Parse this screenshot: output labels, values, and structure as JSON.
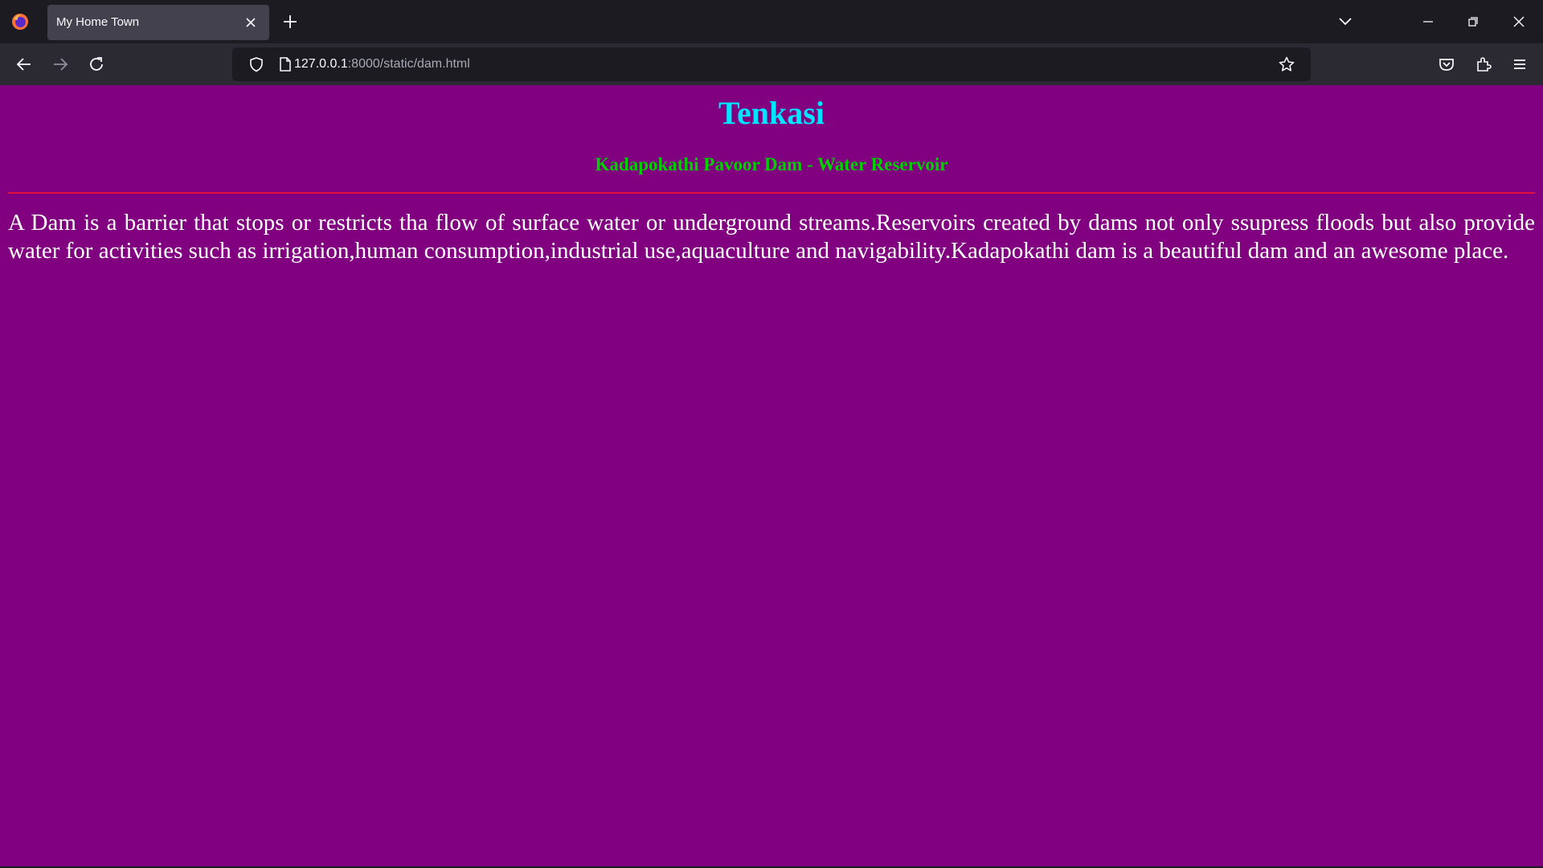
{
  "browser": {
    "tab": {
      "title": "My Home Town"
    },
    "url": {
      "host": "127.0.0.1",
      "path": ":8000/static/dam.html"
    }
  },
  "page": {
    "title": "Tenkasi",
    "subtitle": "Kadapokathi Pavoor Dam - Water Reservoir",
    "body": "A Dam is a barrier that stops or restricts tha flow of surface water or underground streams.Reservoirs created by dams not only ssupress floods but also provide water for activities such as irrigation,human consumption,industrial use,aquaculture and navigability.Kadapokathi dam is a beautiful dam and an awesome place."
  },
  "colors": {
    "background": "#800080",
    "title": "#00e5ff",
    "subtitle": "#00d000",
    "divider": "#e01040",
    "body_text": "#ffffff"
  },
  "icons": [
    "firefox-logo-icon",
    "close-icon",
    "plus-icon",
    "chevron-down-icon",
    "minimize-icon",
    "restore-icon",
    "close-window-icon",
    "back-arrow-icon",
    "forward-arrow-icon",
    "reload-icon",
    "shield-icon",
    "page-icon",
    "star-icon",
    "pocket-icon",
    "extensions-icon",
    "hamburger-menu-icon"
  ]
}
